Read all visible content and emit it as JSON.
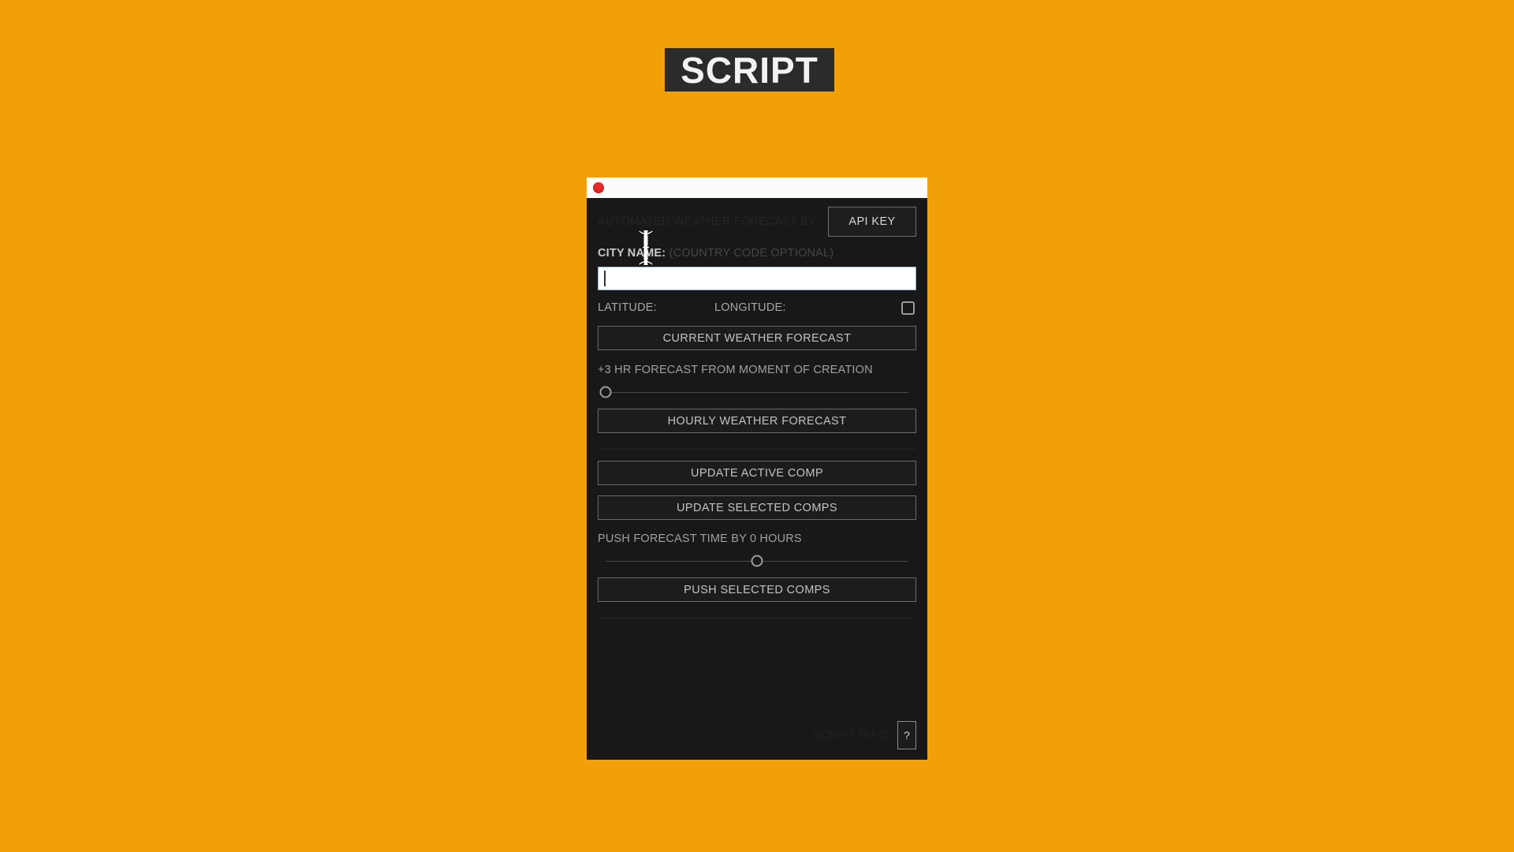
{
  "page": {
    "background_color": "#F2A008",
    "title_badge": {
      "text": "SCRIPT",
      "background_color": "#2B2B2B",
      "text_color": "#F2F2F2"
    }
  },
  "panel": {
    "accent_color": "#F2A008",
    "body_color": "#181818",
    "titlebar": {
      "background_color": "#FCFCFC",
      "close_color": "#EC2A2A"
    },
    "header": {
      "script_title": "AUTOMATED WEATHER FORECAST BY",
      "api_key_label": "API KEY"
    },
    "city": {
      "label": "CITY NAME:",
      "hint": "(COUNTRY CODE OPTIONAL)",
      "input_value": "",
      "input_placeholder": ""
    },
    "coords": {
      "latitude_label": "LATITUDE:",
      "latitude_value": "",
      "longitude_label": "LONGITUDE:",
      "longitude_value": "",
      "checkbox_checked": false
    },
    "actions": {
      "current_weather_forecast": "CURRENT WEATHER FORECAST",
      "hourly_weather_forecast": "HOURLY WEATHER FORECAST",
      "update_active_comp": "UPDATE ACTIVE COMP",
      "update_selected_comps": "UPDATE SELECTED COMPS",
      "push_selected_comps": "PUSH SELECTED COMPS"
    },
    "hour_offset_slider": {
      "label": "+3 HR FORECAST FROM MOMENT OF CREATION",
      "value_percent": 0
    },
    "push_time_slider": {
      "label": "PUSH FORECAST TIME BY 0 HOURS",
      "hours": 0,
      "value_percent": 50
    },
    "footer": {
      "script_info": "SCRIPT INFO",
      "help_label": "?"
    }
  }
}
